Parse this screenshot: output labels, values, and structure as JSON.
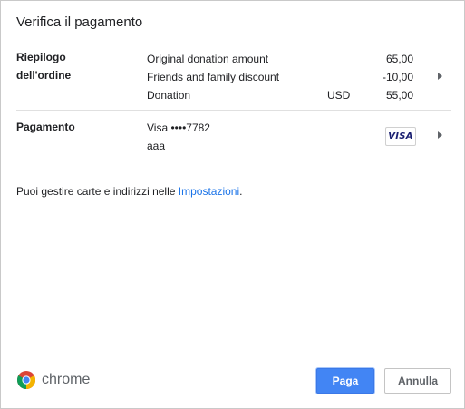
{
  "dialog": {
    "title": "Verifica il pagamento"
  },
  "order_summary": {
    "label_line1": "Riepilogo",
    "label_line2": "dell'ordine",
    "items": [
      {
        "description": "Original donation amount",
        "currency": "",
        "amount": "65,00"
      },
      {
        "description": "Friends and family discount",
        "currency": "",
        "amount": "-10,00"
      },
      {
        "description": "Donation",
        "currency": "USD",
        "amount": "55,00"
      }
    ]
  },
  "payment": {
    "label": "Pagamento",
    "card_line": "Visa  ••••7782",
    "cardholder": "aaa",
    "card_brand_icon": "visa-logo",
    "card_brand_text": "VISA"
  },
  "info": {
    "text_before": "Puoi gestire carte e indirizzi nelle ",
    "link_text": "Impostazioni",
    "text_after": "."
  },
  "footer": {
    "brand": "chrome",
    "brand_icon": "chrome-logo-icon",
    "pay_button": "Paga",
    "cancel_button": "Annulla"
  },
  "colors": {
    "primary_button": "#4285f4",
    "link": "#1a73e8",
    "visa_blue": "#1a1f71"
  }
}
